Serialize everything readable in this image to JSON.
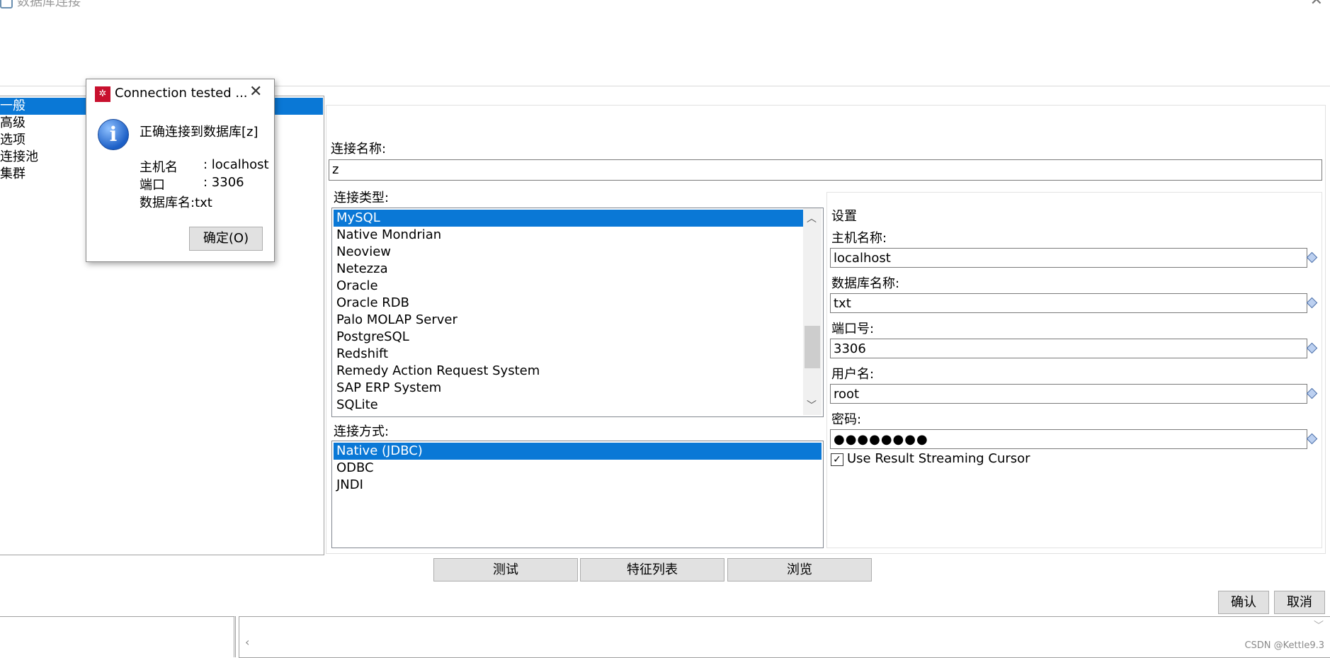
{
  "window": {
    "title": "数据库连接"
  },
  "tree": {
    "items": [
      "一般",
      "高级",
      "选项",
      "连接池",
      "集群"
    ],
    "selected_index": 0
  },
  "connection_name": {
    "label": "连接名称:",
    "value": "z"
  },
  "connection_type": {
    "label": "连接类型:",
    "items": [
      "MySQL",
      "Native Mondrian",
      "Neoview",
      "Netezza",
      "Oracle",
      "Oracle RDB",
      "Palo MOLAP Server",
      "PostgreSQL",
      "Redshift",
      "Remedy Action Request System",
      "SAP ERP System",
      "SQLite"
    ],
    "selected": "MySQL"
  },
  "access": {
    "label": "连接方式:",
    "items": [
      "Native (JDBC)",
      "ODBC",
      "JNDI"
    ],
    "selected": "Native (JDBC)"
  },
  "settings": {
    "title": "设置",
    "host_label": "主机名称:",
    "host_value": "localhost",
    "db_label": "数据库名称:",
    "db_value": "txt",
    "port_label": "端口号:",
    "port_value": "3306",
    "user_label": "用户名:",
    "user_value": "root",
    "password_label": "密码:",
    "password_value": "●●●●●●●●",
    "streaming_label": "Use Result Streaming Cursor",
    "streaming_checked": true
  },
  "buttons": {
    "test": "测试",
    "features": "特征列表",
    "explore": "浏览",
    "ok": "确认",
    "cancel": "取消"
  },
  "dialog": {
    "title": "Connection tested ...",
    "message": "正确连接到数据库[z]",
    "host_key": "主机名",
    "host_val": ": localhost",
    "port_key": "端口",
    "port_val": ": 3306",
    "db_line": "数据库名:txt",
    "ok_label": "确定(O)"
  },
  "watermark": "CSDN @Kettle9.3",
  "colors": {
    "selection": "#0a78d6",
    "app_icon": "#c8102e"
  }
}
